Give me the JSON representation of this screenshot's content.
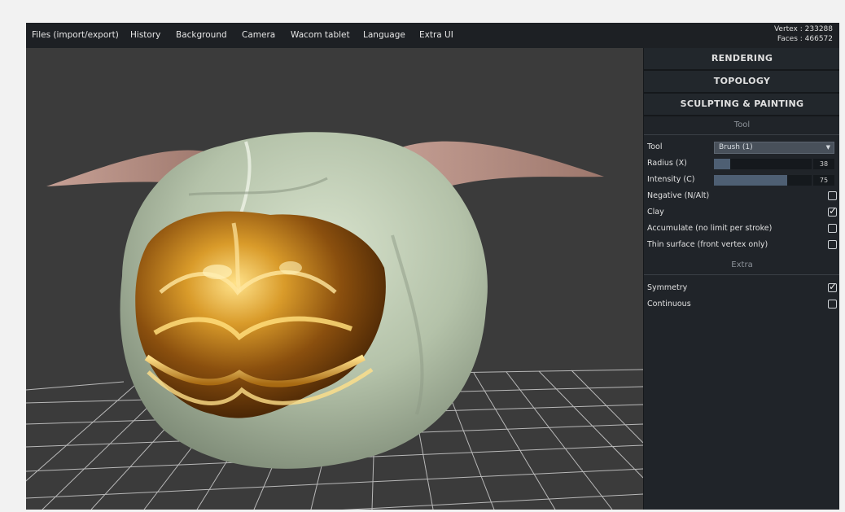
{
  "menubar": {
    "items": [
      "Files (import/export)",
      "History",
      "Background",
      "Camera",
      "Wacom tablet",
      "Language",
      "Extra UI"
    ],
    "vertex": "Vertex : 233288",
    "faces": "Faces : 466572"
  },
  "panel": {
    "sections": [
      "RENDERING",
      "TOPOLOGY",
      "SCULPTING & PAINTING"
    ],
    "tool_header": "Tool",
    "tool_label": "Tool",
    "tool_value": "Brush (1)",
    "radius_label": "Radius (X)",
    "radius_value": "38",
    "radius_level": 0.17,
    "intensity_label": "Intensity (C)",
    "intensity_value": "75",
    "intensity_level": 0.75,
    "negative_label": "Negative (N/Alt)",
    "negative_checked": false,
    "clay_label": "Clay",
    "clay_checked": true,
    "accumulate_label": "Accumulate (no limit per stroke)",
    "accumulate_checked": false,
    "thin_label": "Thin surface (front vertex only)",
    "thin_checked": false,
    "extra_header": "Extra",
    "symmetry_label": "Symmetry",
    "symmetry_checked": true,
    "continuous_label": "Continuous",
    "continuous_checked": false
  },
  "colors": {
    "viewport_bg": "#3b3b3b",
    "grid": "#d8d8d8",
    "skin": "#b9c6b0",
    "horn": "#b08a7e",
    "gold": "#b97d1d",
    "panel_bg": "#202429"
  }
}
